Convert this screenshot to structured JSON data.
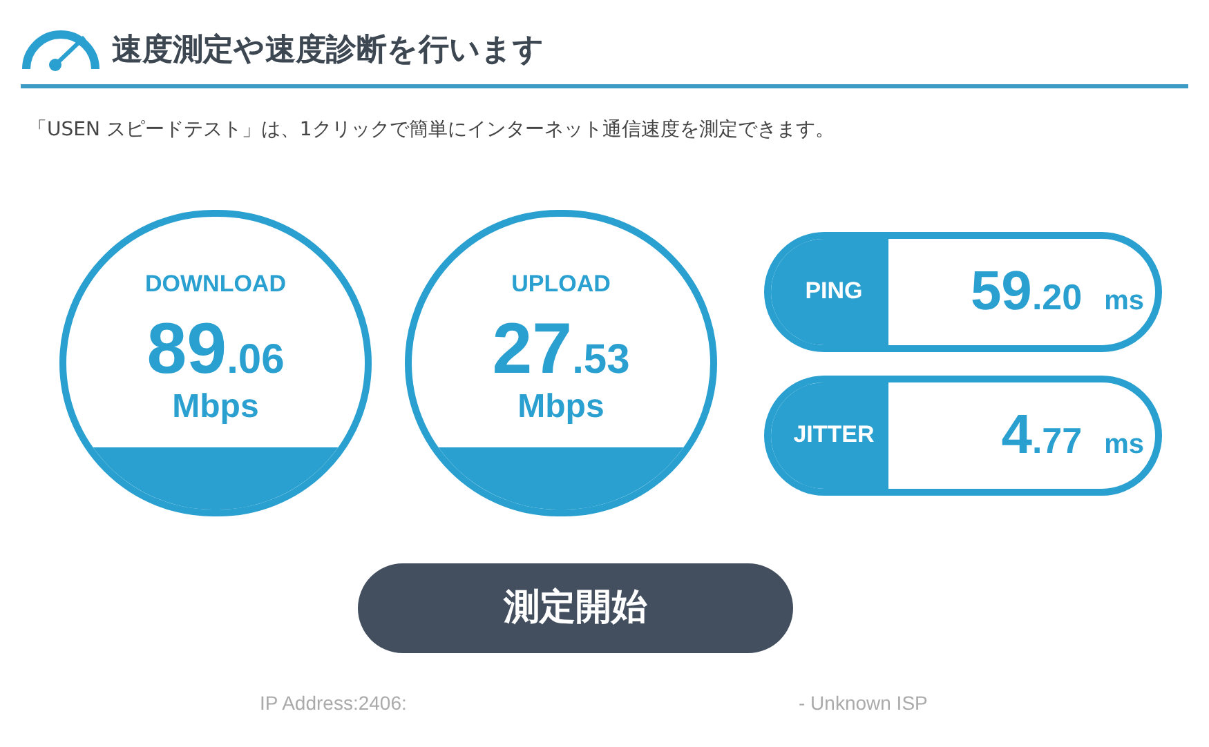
{
  "header": {
    "title": "速度測定や速度診断を行います"
  },
  "description": "「USEN スピードテスト」は、1クリックで簡単にインターネット通信速度を測定できます。",
  "gauges": [
    {
      "label": "DOWNLOAD",
      "integer": "89",
      "decimal": ".06",
      "unit": "Mbps"
    },
    {
      "label": "UPLOAD",
      "integer": "27",
      "decimal": ".53",
      "unit": "Mbps"
    }
  ],
  "metrics": [
    {
      "label": "PING",
      "integer": "59",
      "decimal": ".20",
      "unit": "ms"
    },
    {
      "label": "JITTER",
      "integer": "4",
      "decimal": ".77",
      "unit": "ms"
    }
  ],
  "start_button": "測定開始",
  "footer": {
    "ip_address": "IP Address:2406:",
    "isp": "- Unknown ISP"
  }
}
